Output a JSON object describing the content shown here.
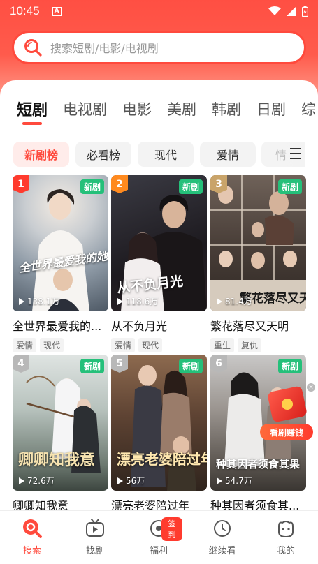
{
  "status_bar": {
    "time": "10:45",
    "notification_glyph": "A"
  },
  "search": {
    "placeholder": "搜索短剧/电影/电视剧"
  },
  "category_tabs": [
    {
      "label": "短剧",
      "active": true
    },
    {
      "label": "电视剧"
    },
    {
      "label": "电影"
    },
    {
      "label": "美剧"
    },
    {
      "label": "韩剧"
    },
    {
      "label": "日剧"
    },
    {
      "label": "综"
    }
  ],
  "filter_chips": [
    {
      "label": "新剧榜",
      "active": true
    },
    {
      "label": "必看榜"
    },
    {
      "label": "现代"
    },
    {
      "label": "爱情"
    },
    {
      "label": "情"
    }
  ],
  "colors": {
    "accent": "#ff4a3d",
    "new_badge": "#25c07a"
  },
  "dramas": [
    {
      "rank": "1",
      "badge": "新剧",
      "plays": "138.1万",
      "poster_text": "全世界最爱我的她",
      "title": "全世界最爱我的...",
      "tags": [
        "爱情",
        "现代"
      ]
    },
    {
      "rank": "2",
      "badge": "新剧",
      "plays": "118.6万",
      "poster_text": "从不负月光",
      "title": "从不负月光",
      "tags": [
        "爱情",
        "现代"
      ]
    },
    {
      "rank": "3",
      "badge": "新剧",
      "plays": "81.4万",
      "poster_text": "繁花落尽又天明",
      "title": "繁花落尽又天明",
      "tags": [
        "重生",
        "复仇"
      ]
    },
    {
      "rank": "4",
      "badge": "新剧",
      "plays": "72.6万",
      "poster_text": "卿卿知我意",
      "title": "卿卿知我意",
      "tags": []
    },
    {
      "rank": "5",
      "badge": "新剧",
      "plays": "56万",
      "poster_text": "漂亮老婆陪过年",
      "title": "漂亮老婆陪过年",
      "tags": []
    },
    {
      "rank": "6",
      "badge": "新剧",
      "plays": "54.7万",
      "poster_text": "种其因者须食其果",
      "title": "种其因者须食其...",
      "tags": []
    }
  ],
  "promo": {
    "label": "看剧赚钱",
    "close": "×"
  },
  "bottom_nav": [
    {
      "label": "搜索",
      "icon": "search-icon",
      "active": true
    },
    {
      "label": "找剧",
      "icon": "tv-icon"
    },
    {
      "label": "福利",
      "icon": "coin-icon",
      "badge": "签到"
    },
    {
      "label": "继续看",
      "icon": "clock-icon"
    },
    {
      "label": "我的",
      "icon": "profile-icon"
    }
  ]
}
